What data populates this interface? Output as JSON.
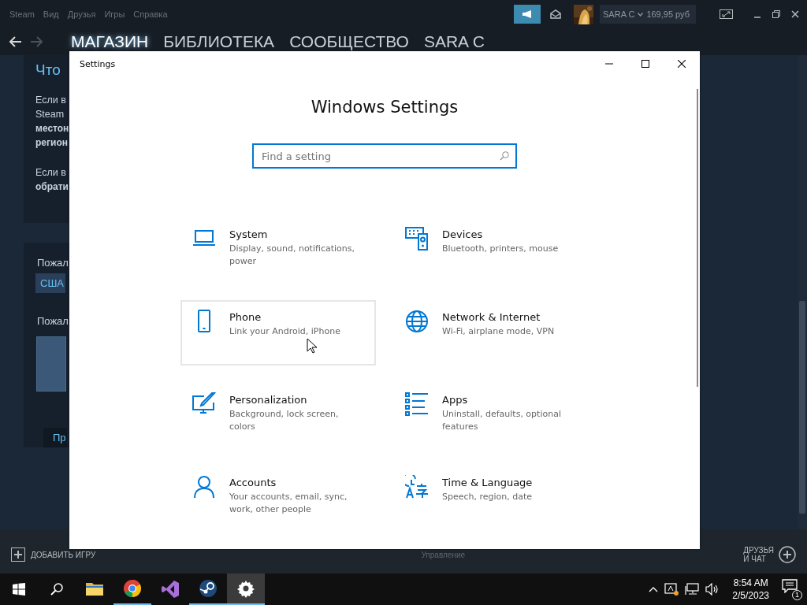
{
  "steam": {
    "menu": [
      "Steam",
      "Вид",
      "Друзья",
      "Игры",
      "Справка"
    ],
    "account": {
      "name": "SARA C",
      "balance": "169,95 руб"
    },
    "nav": [
      {
        "label": "МАГАЗИН",
        "selected": true
      },
      {
        "label": "БИБЛИОТЕКА",
        "selected": false
      },
      {
        "label": "СООБЩЕСТВО",
        "selected": false
      },
      {
        "label": "SARA C",
        "selected": false
      }
    ],
    "content": {
      "heading": "Что",
      "paragraphs": [
        [
          {
            "text": "Если в",
            "bold": false
          },
          {
            "text": "Steam",
            "bold": false
          },
          {
            "text": "местон",
            "bold": true
          },
          {
            "text": "регион",
            "bold": true
          }
        ],
        [
          {
            "text": "Если в",
            "bold": false
          },
          {
            "text": "обрати",
            "bold": true
          }
        ]
      ],
      "country_label": "Пожал",
      "country": "США",
      "second_label": "Пожал",
      "button": "Пр"
    },
    "bottom": {
      "add_game": "ДОБАВИТЬ ИГРУ",
      "manage": "Управление",
      "friends": [
        "ДРУЗЬЯ",
        "И ЧАТ"
      ]
    }
  },
  "settings": {
    "title": "Settings",
    "heading": "Windows Settings",
    "search": {
      "placeholder": "Find a setting"
    },
    "items": [
      {
        "kind": "laptop",
        "title": "System",
        "description": "Display, sound, notifications, power",
        "hovered": false
      },
      {
        "kind": "devices",
        "title": "Devices",
        "description": "Bluetooth, printers, mouse",
        "hovered": false
      },
      {
        "kind": "phone",
        "title": "Phone",
        "description": "Link your Android, iPhone",
        "hovered": true
      },
      {
        "kind": "globe",
        "title": "Network & Internet",
        "description": "Wi-Fi, airplane mode, VPN",
        "hovered": false
      },
      {
        "kind": "brush",
        "title": "Personalization",
        "description": "Background, lock screen, colors",
        "hovered": false
      },
      {
        "kind": "apps",
        "title": "Apps",
        "description": "Uninstall, defaults, optional features",
        "hovered": false
      },
      {
        "kind": "person",
        "title": "Accounts",
        "description": "Your accounts, email, sync, work, other people",
        "hovered": false
      },
      {
        "kind": "clock",
        "title": "Time & Language",
        "description": "Speech, region, date",
        "hovered": false
      }
    ]
  },
  "taskbar": {
    "apps": [
      {
        "kind": "folder",
        "running": false,
        "selected": false
      },
      {
        "kind": "browser",
        "running": true,
        "selected": false
      },
      {
        "kind": "studio",
        "running": false,
        "selected": false
      },
      {
        "kind": "steam",
        "running": true,
        "selected": false
      },
      {
        "kind": "gear",
        "running": true,
        "selected": true
      }
    ],
    "time": "8:54 AM",
    "date": "2/5/2023",
    "notifications": "1"
  }
}
